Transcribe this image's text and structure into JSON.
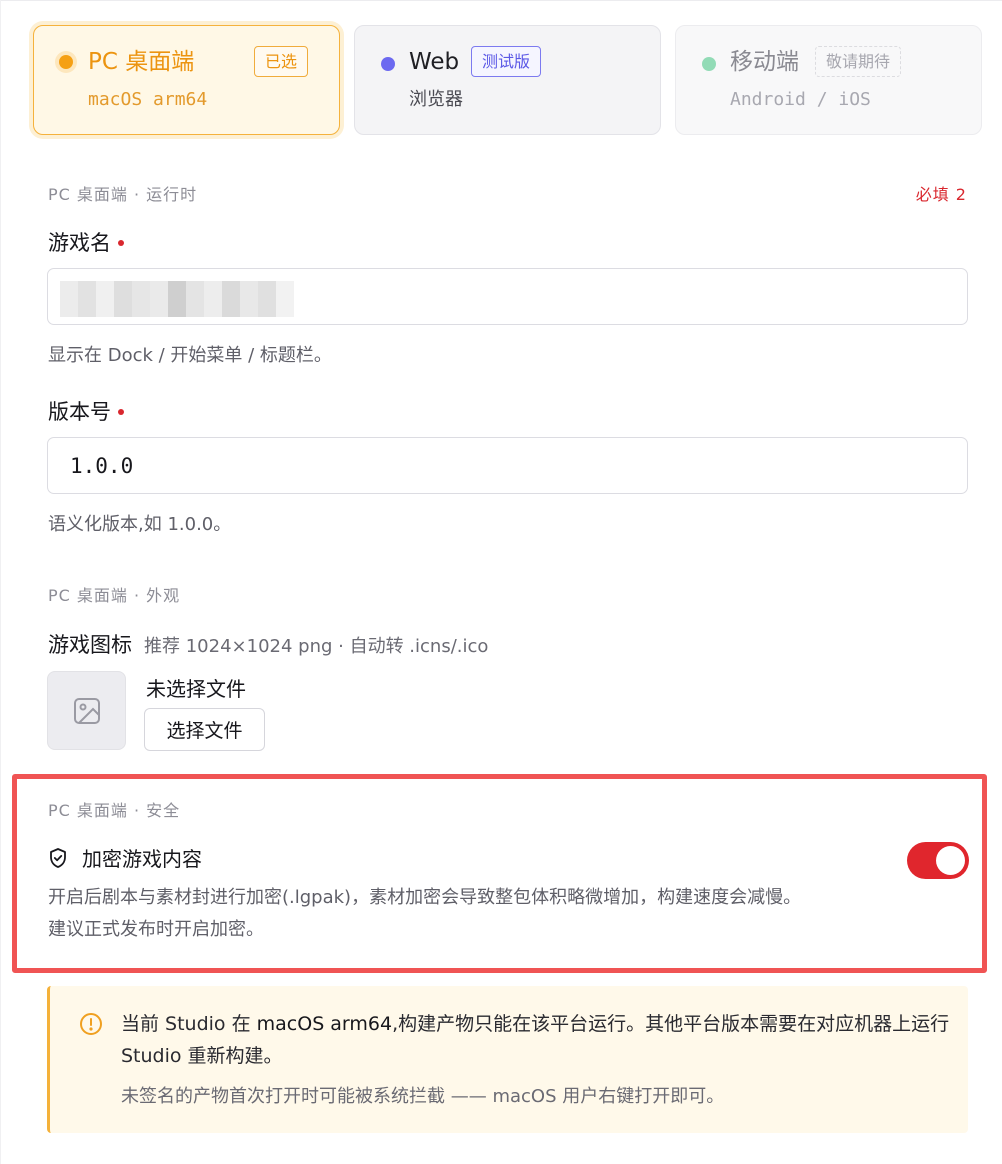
{
  "platforms": {
    "pc": {
      "title": "PC 桌面端",
      "badge": "已选",
      "subtitle": "macOS arm64",
      "color": "#f5a014"
    },
    "web": {
      "title": "Web",
      "badge": "测试版",
      "subtitle": "浏览器",
      "color": "#6c69f0"
    },
    "mobile": {
      "title": "移动端",
      "badge": "敬请期待",
      "subtitle": "Android / iOS",
      "color": "#92dbb6"
    }
  },
  "runtime": {
    "section_label": "PC 桌面端 · 运行时",
    "required_count": "必填 2",
    "game_name": {
      "label": "游戏名",
      "helper": "显示在 Dock / 开始菜单 / 标题栏。"
    },
    "version": {
      "label": "版本号",
      "value": "1.0.0",
      "helper": "语义化版本,如 1.0.0。"
    }
  },
  "appearance": {
    "section_label": "PC 桌面端 · 外观",
    "icon_label": "游戏图标",
    "icon_hint": "推荐 1024×1024 png · 自动转 .icns/.ico",
    "no_file": "未选择文件",
    "choose_button": "选择文件"
  },
  "security": {
    "section_label": "PC 桌面端 · 安全",
    "encrypt_label": "加密游戏内容",
    "encrypt_desc_1": "开启后剧本与素材封进行加密(.lgpak)，素材加密会导致整包体积略微增加，构建速度会减慢。",
    "encrypt_desc_2": "建议正式发布时开启加密。",
    "encrypt_enabled": true,
    "accent": "#e0262d"
  },
  "notice": {
    "main_prefix": "当前 Studio 在 ",
    "main_platform": "macOS arm64",
    "main_suffix": ",构建产物只能在该平台运行。其他平台版本需要在对应机器上运行 Studio 重新构建。",
    "sub": "未签名的产物首次打开时可能被系统拦截 —— macOS 用户右键打开即可。"
  }
}
